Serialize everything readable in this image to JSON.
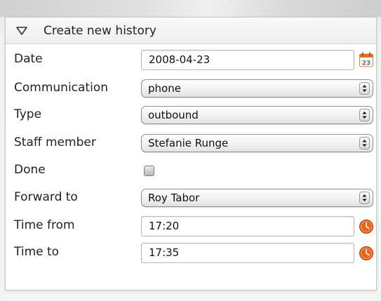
{
  "panel": {
    "title": "Create new history",
    "collapse_icon": "triangle-down-icon"
  },
  "fields": {
    "date": {
      "label": "Date",
      "value": "2008-04-23",
      "icon": "calendar-icon",
      "icon_day": "23"
    },
    "communication": {
      "label": "Communication",
      "value": "phone"
    },
    "type": {
      "label": "Type",
      "value": "outbound"
    },
    "staff_member": {
      "label": "Staff member",
      "value": "Stefanie Runge"
    },
    "done": {
      "label": "Done",
      "checked": false
    },
    "forward_to": {
      "label": "Forward to",
      "value": "Roy Tabor"
    },
    "time_from": {
      "label": "Time from",
      "value": "17:20",
      "icon": "clock-icon"
    },
    "time_to": {
      "label": "Time to",
      "value": "17:35",
      "icon": "clock-icon"
    }
  },
  "colors": {
    "calendar_accent": "#e8701a",
    "clock_accent": "#e8631c"
  }
}
